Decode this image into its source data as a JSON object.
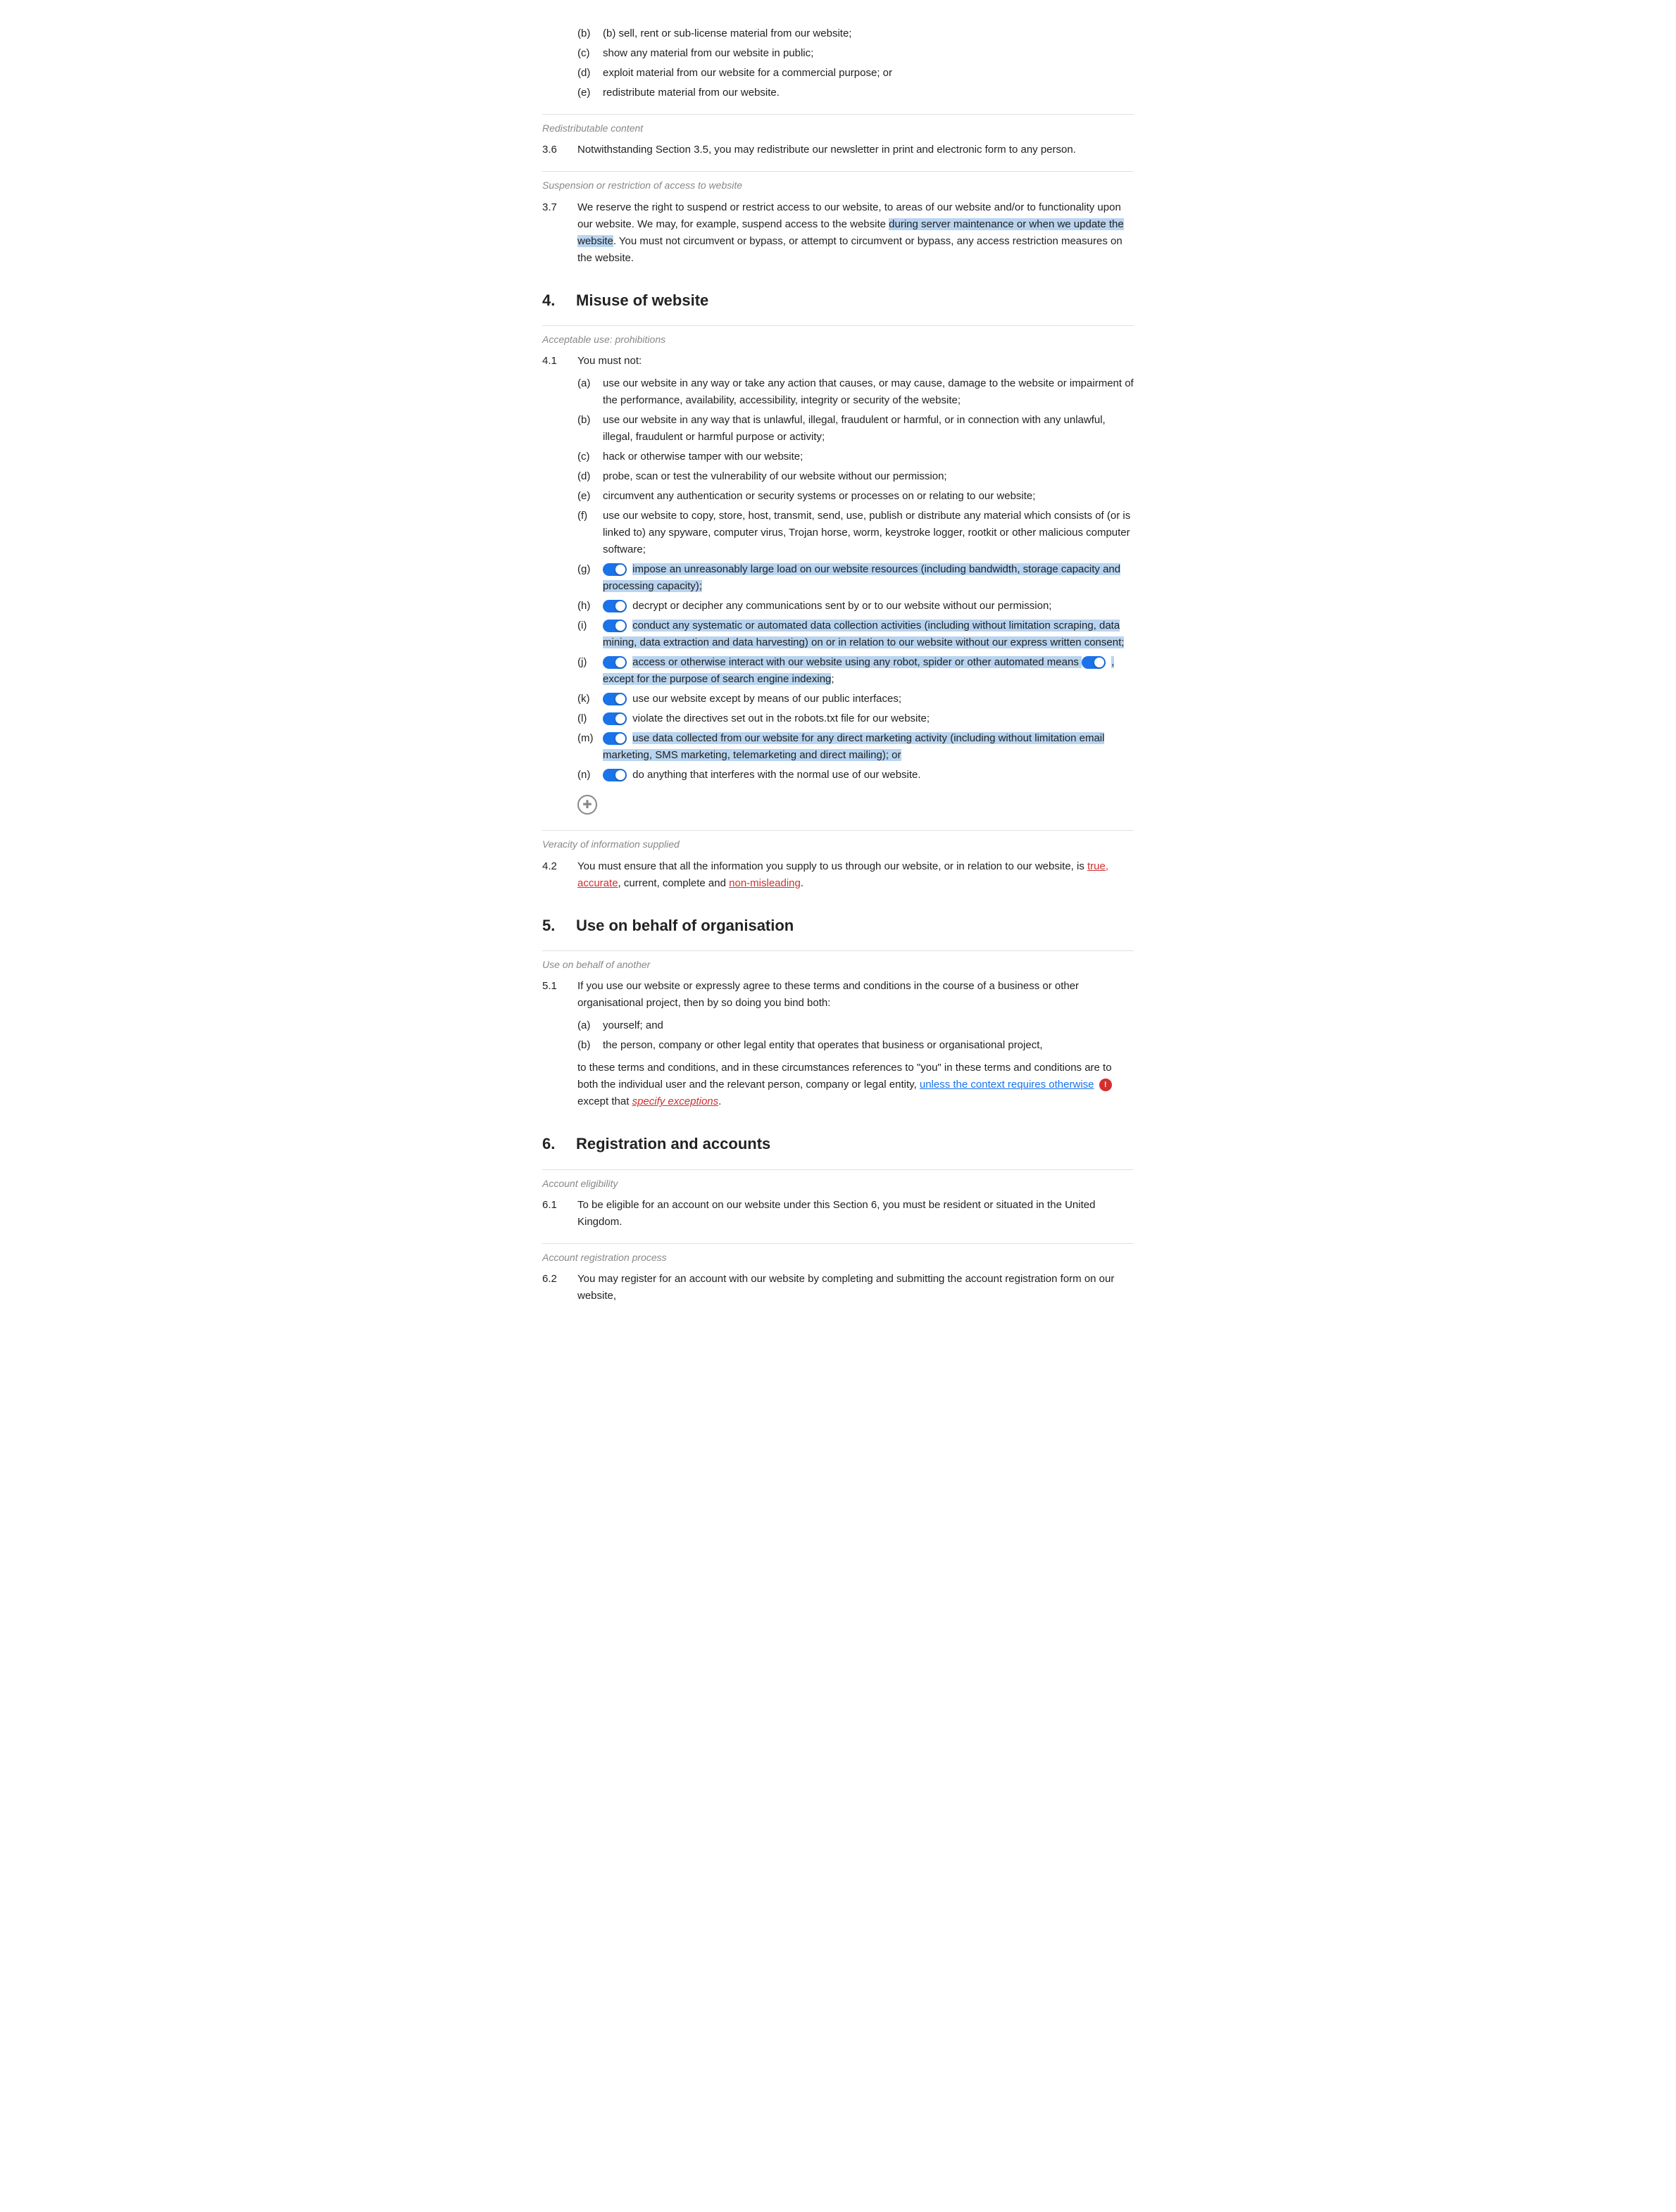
{
  "sections": {
    "section3": {
      "clauses": {
        "c3_sub_b": "(b)  sell, rent or sub-license material from our website;",
        "c3_sub_c": "(c)  show any material from our website in public;",
        "c3_sub_d": "(d)  exploit material from our website for a commercial purpose; or",
        "c3_sub_e": "(e)  redistribute material from our website.",
        "c3_6_subheading": "Redistributable content",
        "c3_6_num": "3.6",
        "c3_6_text": "Notwithstanding Section 3.5, you may redistribute our newsletter in print and electronic form to any person.",
        "c3_7_subheading": "Suspension or restriction of access to website",
        "c3_7_num": "3.7",
        "c3_7_text_1": "We reserve the right to suspend or restrict access to our website, to areas of our website and/or to functionality upon our website. We may, for example, suspend access to the website ",
        "c3_7_text_2": "during server maintenance or when we update the website",
        "c3_7_text_3": ". You must not circumvent or bypass, or attempt to circumvent or bypass, any access restriction measures on the website."
      }
    },
    "section4": {
      "heading_num": "4.",
      "heading_label": "Misuse of website",
      "sub1_heading": "Acceptable use: prohibitions",
      "c4_1_num": "4.1",
      "c4_1_text": "You must not:",
      "items": [
        {
          "label": "(a)",
          "text": "use our website in any way or take any action that causes, or may cause, damage to the website or impairment of the performance, availability, accessibility, integrity or security of the website;",
          "toggle": false
        },
        {
          "label": "(b)",
          "text": "use our website in any way that is unlawful, illegal, fraudulent or harmful, or in connection with any unlawful, illegal, fraudulent or harmful purpose or activity;",
          "toggle": false
        },
        {
          "label": "(c)",
          "text": "hack or otherwise tamper with our website;",
          "toggle": false
        },
        {
          "label": "(d)",
          "text": "probe, scan or test the vulnerability of our website without our permission;",
          "toggle": false
        },
        {
          "label": "(e)",
          "text": "circumvent any authentication or security systems or processes on or relating to our website;",
          "toggle": false
        },
        {
          "label": "(f)",
          "text": "use our website to copy, store, host, transmit, send, use, publish or distribute any material which consists of (or is linked to) any spyware, computer virus, Trojan horse, worm, keystroke logger, rootkit or other malicious computer software;",
          "toggle": false
        },
        {
          "label": "(g)",
          "text": "impose an unreasonably large load on our website resources (including bandwidth, storage capacity and processing capacity);",
          "toggle": true,
          "highlight": true
        },
        {
          "label": "(h)",
          "text": "decrypt or decipher any communications sent by or to our website without our permission;",
          "toggle": true,
          "highlight": false
        },
        {
          "label": "(i)",
          "text": "conduct any systematic or automated data collection activities (including without limitation scraping, data mining, data extraction and data harvesting) on or in relation to our website without our express written consent;",
          "toggle": true,
          "highlight": true
        },
        {
          "label": "(j)",
          "text_before": "access or otherwise interact with our website using any robot, spider or other automated means",
          "text_after": ", except for the purpose of search engine indexing;",
          "toggle": true,
          "toggle2": true,
          "highlight": true,
          "highlight_after": true
        },
        {
          "label": "(k)",
          "text": "use our website except by means of our public interfaces;",
          "toggle": true,
          "highlight": false
        },
        {
          "label": "(l)",
          "text": "violate the directives set out in the robots.txt file for our website;",
          "toggle": true,
          "highlight": false
        },
        {
          "label": "(m)",
          "text": "use data collected from our website for any direct marketing activity (including without limitation email marketing, SMS marketing, telemarketing and direct mailing); or",
          "toggle": true,
          "highlight": true
        },
        {
          "label": "(n)",
          "text": "do anything that interferes with the normal use of our website.",
          "toggle": true,
          "highlight": false
        }
      ],
      "sub2_heading": "Veracity of information supplied",
      "c4_2_num": "4.2",
      "c4_2_text_1": "You must ensure that all the information you supply to us through our website, or in relation to our website, is ",
      "c4_2_text_2": "true, accurate",
      "c4_2_text_3": ", current, complete and ",
      "c4_2_text_4": "non-misleading",
      "c4_2_text_5": "."
    },
    "section5": {
      "heading_num": "5.",
      "heading_label": "Use on behalf of organisation",
      "sub1_heading": "Use on behalf of another",
      "c5_1_num": "5.1",
      "c5_1_text": "If you use our website or expressly agree to these terms and conditions in the course of a business or other organisational project, then by so doing you bind both:",
      "c5_1_items": [
        "(a)  yourself; and",
        "(b)  the person, company or other legal entity that operates that business or organisational project,"
      ],
      "c5_1_para": "to these terms and conditions, and in these circumstances references to \"you\" in these terms and conditions are to both the individual user and the relevant person, company or legal entity, ",
      "c5_1_underline": "unless the context requires otherwise",
      "c5_1_badge": "!",
      "c5_1_except": " except that ",
      "c5_1_specify": "specify exceptions",
      "c5_1_dot": "."
    },
    "section6": {
      "heading_num": "6.",
      "heading_label": "Registration and accounts",
      "sub1_heading": "Account eligibility",
      "c6_1_num": "6.1",
      "c6_1_text": "To be eligible for an account on our website under this Section 6, you must be resident or situated in the United Kingdom.",
      "sub2_heading": "Account registration process",
      "c6_2_num": "6.2",
      "c6_2_text": "You may register for an account with our website by completing and submitting the account registration form on our website,"
    }
  }
}
